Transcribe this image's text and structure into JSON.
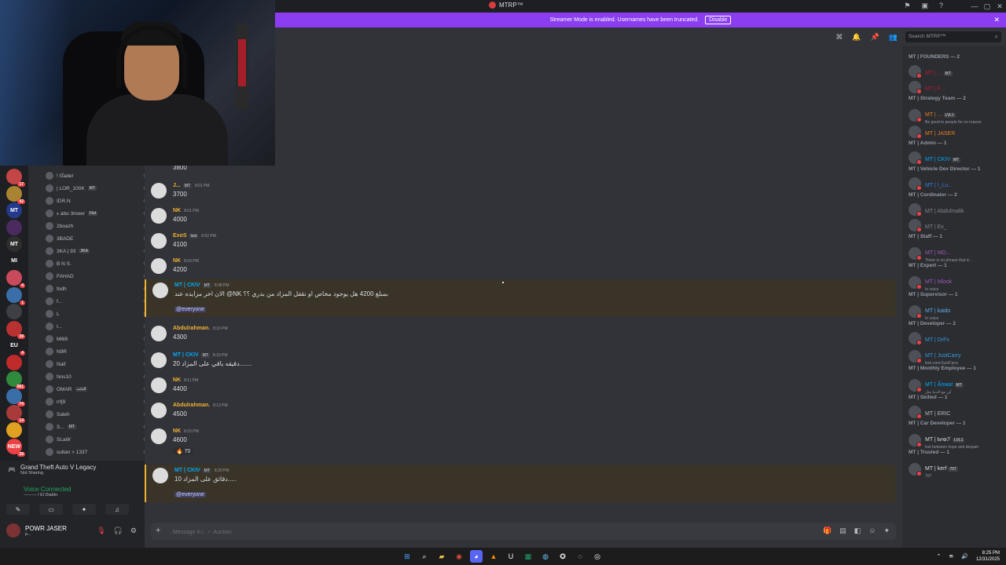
{
  "window": {
    "title": "MTRP™"
  },
  "banner": {
    "text": "Streamer Mode is enabled. Usernames have been truncated.",
    "button": "Disable"
  },
  "search": {
    "placeholder": "Search MTRP™"
  },
  "servers": [
    {
      "label": "",
      "color": "#c34545",
      "badge": "17"
    },
    {
      "label": "",
      "color": "#a88432",
      "badge": "42"
    },
    {
      "label": "MT",
      "color": "#243a8c",
      "badge": ""
    },
    {
      "label": "",
      "color": "#4b2a5f",
      "badge": ""
    },
    {
      "label": "MT",
      "color": "#2e2e2e",
      "badge": ""
    },
    {
      "label": "MI",
      "color": "#1e1f22",
      "badge": ""
    },
    {
      "label": "",
      "color": "#c94a5b",
      "badge": "4"
    },
    {
      "label": "",
      "color": "#3a6ea8",
      "badge": "1"
    },
    {
      "label": "",
      "color": "#3d3f45",
      "badge": ""
    },
    {
      "label": "",
      "color": "#b83232",
      "badge": "39"
    },
    {
      "label": "EU",
      "color": "#1e1f22",
      "badge": "4"
    },
    {
      "label": "",
      "color": "#c02a2a",
      "badge": ""
    },
    {
      "label": "",
      "color": "#2f8a3b",
      "badge": "681"
    },
    {
      "label": "",
      "color": "#3a6ea8",
      "badge": "74"
    },
    {
      "label": "",
      "color": "#a83a3a",
      "badge": "14"
    },
    {
      "label": "",
      "color": "#e0a020",
      "badge": ""
    },
    {
      "label": "NEW",
      "color": "#ed4245",
      "badge": "28"
    }
  ],
  "voice_users": [
    {
      "name": "! Ɠader",
      "tag": ""
    },
    {
      "name": "| LOR_100K",
      "tag": "MT"
    },
    {
      "name": "IDR.N",
      "tag": ""
    },
    {
      "name": "ء abo 3meer",
      "tag": "Flet"
    },
    {
      "name": "2boazh",
      "tag": ""
    },
    {
      "name": "3BADE",
      "tag": ""
    },
    {
      "name": "3KA | 93",
      "tag": "3KA"
    },
    {
      "name": "B N S.",
      "tag": ""
    },
    {
      "name": "FAHAD",
      "tag": ""
    },
    {
      "name": "fodh",
      "tag": ""
    },
    {
      "name": "f...",
      "tag": ""
    },
    {
      "name": "L",
      "tag": ""
    },
    {
      "name": "I...",
      "tag": ""
    },
    {
      "name": "M6l8",
      "tag": ""
    },
    {
      "name": "N9R",
      "tag": ""
    },
    {
      "name": "Naif",
      "tag": ""
    },
    {
      "name": "Nos10",
      "tag": ""
    },
    {
      "name": "OMAR",
      "tag": "الذئب"
    },
    {
      "name": "rrfj9",
      "tag": ""
    },
    {
      "name": "Saleh",
      "tag": ""
    },
    {
      "name": "S...",
      "tag": "MT"
    },
    {
      "name": "SLaW",
      "tag": ""
    },
    {
      "name": "sultan > 1337",
      "tag": ""
    }
  ],
  "activity": {
    "game": "Grand Theft Auto V Legacy",
    "game_status": "Not Sharing",
    "voice_status": "Voice Connected",
    "voice_channel": "--------- / El Diablo",
    "username": "POWR JASER",
    "user_status": "p..."
  },
  "messages": [
    {
      "name": "",
      "time": "",
      "text": "3800",
      "color": "#dbdee1",
      "tag": ""
    },
    {
      "name": "J...",
      "time": "8:01 PM",
      "text": "3700",
      "color": "#f0b232",
      "tag": "MT"
    },
    {
      "name": "NK",
      "time": "8:01 PM",
      "text": "4000",
      "color": "#f0b232",
      "tag": ""
    },
    {
      "name": "ExoS",
      "time": "8:02 PM",
      "text": "4100",
      "color": "#f0b232",
      "tag": "lost"
    },
    {
      "name": "NK",
      "time": "8:03 PM",
      "text": "4200",
      "color": "#f0b232",
      "tag": ""
    },
    {
      "name": "MT | CKIV",
      "time": "8:08 PM",
      "text": "الان اخر مزايده عند @NK بمبلغ 4200 هل يوجود مخاص او نقفل المزاد من بدري ؟؟",
      "color": "#00a8fc",
      "tag": "MT",
      "mention": "@everyone"
    },
    {
      "name": "Abdulrahman.",
      "time": "8:10 PM",
      "text": "4300",
      "color": "#f0b232",
      "tag": ""
    },
    {
      "name": "MT | CKIV",
      "time": "8:10 PM",
      "text": "20 دقيقه باقي على المزاد.......",
      "color": "#00a8fc",
      "tag": "MT"
    },
    {
      "name": "NK",
      "time": "8:11 PM",
      "text": "4400",
      "color": "#f0b232",
      "tag": ""
    },
    {
      "name": "Abdulrahman.",
      "time": "8:13 PM",
      "text": "4500",
      "color": "#f0b232",
      "tag": ""
    },
    {
      "name": "NK",
      "time": "8:15 PM",
      "text": "4600",
      "color": "#f0b232",
      "tag": "",
      "reaction": "70"
    },
    {
      "name": "MT | CKIV",
      "time": "8:20 PM",
      "text": "10 دقائق على المزاد.....",
      "color": "#00a8fc",
      "tag": "MT",
      "mention": "@everyone"
    }
  ],
  "composer": {
    "placeholder": "Message #♨ ・ Auction"
  },
  "members": [
    {
      "role": "MT | FOUNDERS — 2"
    },
    {
      "name": "MT | ...",
      "color": "#b71c30",
      "tag": "MT",
      "status": ""
    },
    {
      "name": "MT | F...",
      "color": "#b71c30",
      "tag": "",
      "status": ""
    },
    {
      "role": "MT | Strategy Team — 2"
    },
    {
      "name": "MT | ...",
      "color": "#e67e22",
      "tag": "LVL1",
      "status": "Be good to people for no reason"
    },
    {
      "name": "MT | JASER",
      "color": "#e67e22",
      "tag": "",
      "status": ""
    },
    {
      "role": "MT | Admin — 1"
    },
    {
      "name": "MT | CKIV",
      "color": "#00a8fc",
      "tag": "MT",
      "status": ""
    },
    {
      "role": "MT | Vehicle Dev Director — 1"
    },
    {
      "name": "MT | \\_Lu...",
      "color": "#3a7bd5",
      "tag": "",
      "status": ""
    },
    {
      "role": "MT | Cordinator — 2"
    },
    {
      "name": "MT | Abdulmalik",
      "color": "#80848e",
      "tag": "",
      "status": ""
    },
    {
      "name": "MT | Ex_",
      "color": "#80848e",
      "tag": "",
      "status": ""
    },
    {
      "role": "MT | Staff — 1"
    },
    {
      "name": "MT | MO...",
      "color": "#9b59b6",
      "tag": "",
      "status": "There is no phrase that d..."
    },
    {
      "role": "MT | Expert — 1"
    },
    {
      "name": "MT | Mlook",
      "color": "#9b59b6",
      "tag": "",
      "status": "In voice"
    },
    {
      "role": "MT | Supervisor — 1"
    },
    {
      "name": "MT | kaido",
      "color": "#5dade2",
      "tag": "",
      "status": "In voice"
    },
    {
      "role": "MT | Developer — 2"
    },
    {
      "name": "MT | DrFx",
      "color": "#3498db",
      "tag": "",
      "status": ""
    },
    {
      "name": "MT | JustCarry",
      "color": "#3498db",
      "tag": "",
      "status": "kick.com/JustCarry"
    },
    {
      "role": "MT | Monthly Employee — 1"
    },
    {
      "name": "MT | Ãnwar",
      "color": "#00a8fc",
      "tag": "MT",
      "status": "كن مع الدنيا مثل"
    },
    {
      "role": "MT | Skilled — 1"
    },
    {
      "name": "MT | ERIC",
      "color": "#bbbbbb",
      "tag": "",
      "status": ""
    },
    {
      "role": "MT | Car Developer — 1"
    },
    {
      "name": "MT | Ƅrꝋℱ",
      "color": "#dbdee1",
      "tag": "LVL1",
      "status": "lost between hope and despair"
    },
    {
      "role": "MT | Trusted — 1"
    },
    {
      "name": "MT | kerf",
      "color": "#dbdee1",
      "tag": "707",
      "status": "707"
    }
  ],
  "taskbar": {
    "time": "8:25 PM",
    "date": "12/31/2025"
  }
}
